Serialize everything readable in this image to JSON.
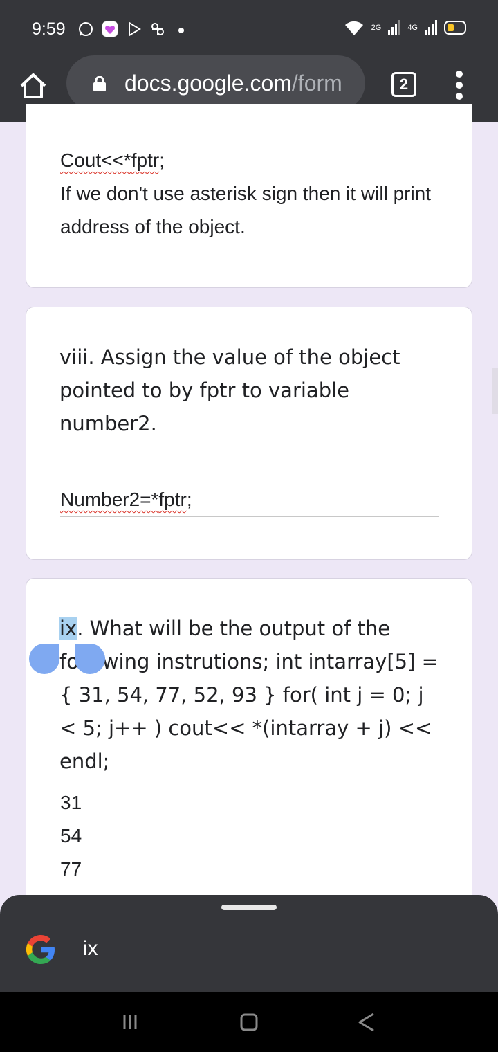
{
  "status": {
    "time": "9:59",
    "net1": "2G",
    "net2": "4G"
  },
  "browser": {
    "url_host": "docs.google.com",
    "url_path": "/form",
    "tab_count": "2"
  },
  "card1": {
    "answer_code": "Cout<<*fptr;",
    "answer_code_parts": [
      "Cout<<*",
      "fptr",
      ";"
    ],
    "answer_text": "If we don't use asterisk sign then it will print address of the object."
  },
  "card2": {
    "question": "viii. Assign the value of the object pointed to by fptr to variable number2.",
    "answer_parts": [
      "Number2=*",
      "fptr",
      ";"
    ]
  },
  "card3": {
    "question_selected": "ix",
    "question_rest": ". What will be the output of the following instrutions; int intarray[5] = { 31, 54, 77, 52, 93 } for( int j = 0; j < 5; j++ ) cout<< *(intarray + j) << endl;",
    "answer_lines": [
      "31",
      "54",
      "77"
    ]
  },
  "search_sheet": {
    "query": "ix"
  },
  "icons": [
    "whatsapp-icon",
    "heart-chat-icon",
    "play-store-icon",
    "link-icon",
    "wifi-icon",
    "signal-icon",
    "battery-icon",
    "home-icon",
    "lock-icon",
    "tabs-icon",
    "menu-icon",
    "google-logo-icon",
    "recents-icon",
    "home-nav-icon",
    "back-icon"
  ]
}
